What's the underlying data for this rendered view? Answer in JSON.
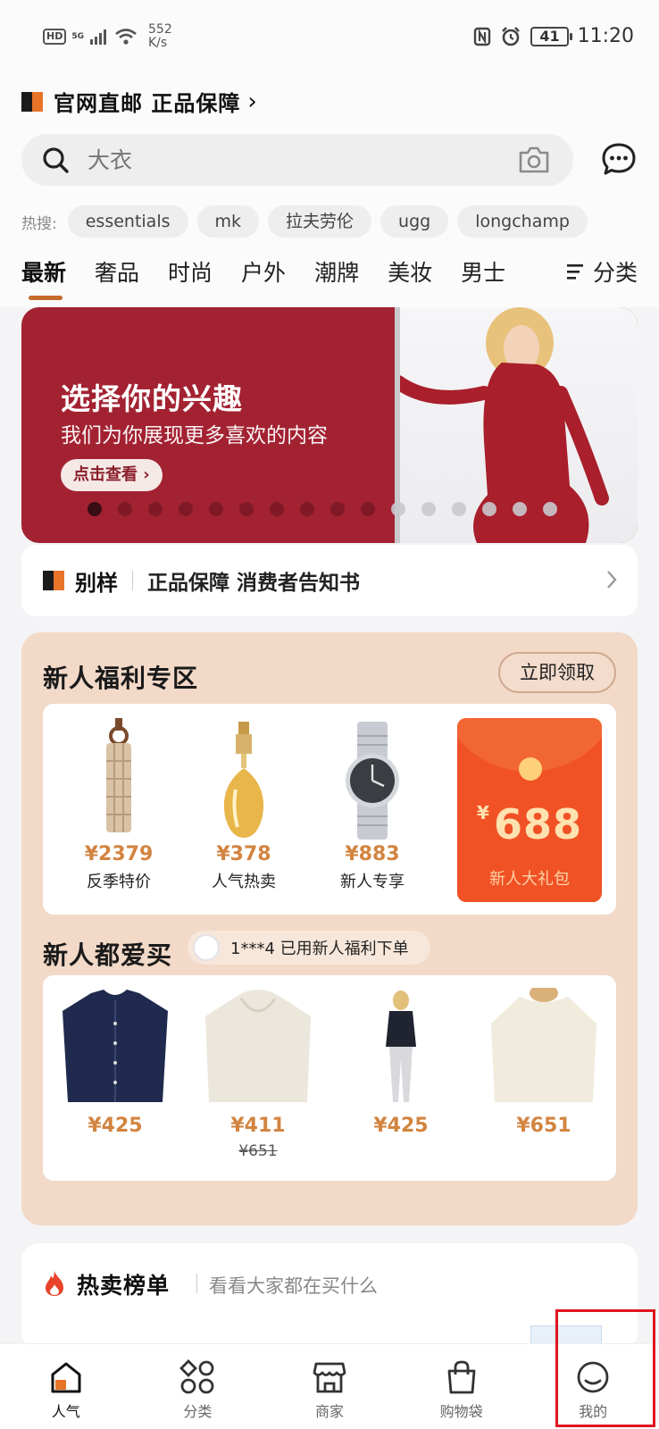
{
  "status_bar": {
    "hd": "HD",
    "signal": "5G",
    "speed_value": "552",
    "speed_unit": "K/s",
    "battery": "41",
    "time": "11:20"
  },
  "header": {
    "brand_text": "官网直邮 正品保障",
    "search_placeholder": "大衣",
    "hot_label": "热搜:",
    "hot_searches": [
      "essentials",
      "mk",
      "拉夫劳伦",
      "ugg",
      "longchamp"
    ],
    "tabs": [
      "最新",
      "奢品",
      "时尚",
      "户外",
      "潮牌",
      "美妆",
      "男士"
    ],
    "category_label": "分类"
  },
  "banner": {
    "title": "选择你的兴趣",
    "subtitle": "我们为你展现更多喜欢的内容",
    "button": "点击查看 ›",
    "dots_total": 16,
    "active_dot": 1
  },
  "guarantee": {
    "brand": "别样",
    "text": "正品保障 消费者告知书"
  },
  "newuser": {
    "title": "新人福利专区",
    "claim_button": "立即领取",
    "items": [
      {
        "price": "¥2379",
        "label": "反季特价",
        "icon": "scarf-keychain-image"
      },
      {
        "price": "¥378",
        "label": "人气热卖",
        "icon": "perfume-bottle-image"
      },
      {
        "price": "¥883",
        "label": "新人专享",
        "icon": "wristwatch-image"
      }
    ],
    "red_packet": {
      "currency": "¥",
      "amount": "688",
      "label": "新人大礼包"
    },
    "love_title": "新人都爱买",
    "ticker": "1***4 已用新人福利下单",
    "products": [
      {
        "price": "¥425",
        "old_price": "",
        "icon": "navy-cardigan-image"
      },
      {
        "price": "¥411",
        "old_price": "¥651",
        "icon": "cream-hoodie-image"
      },
      {
        "price": "¥425",
        "old_price": "",
        "icon": "girl-outfit-image"
      },
      {
        "price": "¥651",
        "old_price": "",
        "icon": "cream-sweater-image"
      }
    ]
  },
  "hotlist": {
    "title": "热卖榜单",
    "subtitle": "看看大家都在买什么"
  },
  "bottom_nav": {
    "items": [
      {
        "label": "人气",
        "icon": "home-icon"
      },
      {
        "label": "分类",
        "icon": "category-grid-icon"
      },
      {
        "label": "商家",
        "icon": "store-icon"
      },
      {
        "label": "购物袋",
        "icon": "shopping-bag-icon"
      },
      {
        "label": "我的",
        "icon": "profile-icon"
      }
    ]
  },
  "colors": {
    "accent": "#c8692d",
    "banner_red": "#a32232",
    "newuser_bg": "#f2d9c8",
    "price": "#d28440",
    "red_packet": "#f05225",
    "highlight": "#e0141e"
  }
}
